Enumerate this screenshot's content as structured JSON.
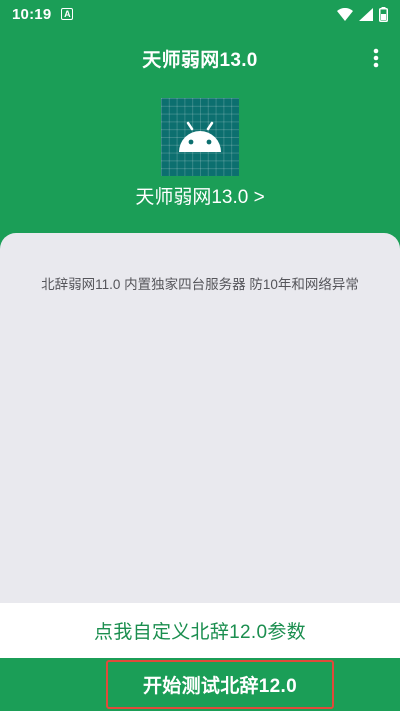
{
  "status_bar": {
    "time": "10:19",
    "notification_icon": "a-icon",
    "icons": [
      "wifi-icon",
      "signal-icon",
      "battery-icon"
    ]
  },
  "toolbar": {
    "title": "天师弱网13.0",
    "menu_icon": "more-vert-icon"
  },
  "header": {
    "app_icon": "android-icon",
    "app_name_link": "天师弱网13.0 >"
  },
  "content": {
    "description": "北辞弱网11.0 内置独家四台服务器 防10年和网络异常"
  },
  "custom_params_button": "点我自定义北辞12.0参数",
  "start_button": "开始测试北辞12.0",
  "colors": {
    "primary": "#1b9e57",
    "card_bg": "#e9e9ee",
    "accent_text": "#1b8e4f",
    "highlight_border": "#e04a3a",
    "icon_bg": "#0c6f6f"
  }
}
